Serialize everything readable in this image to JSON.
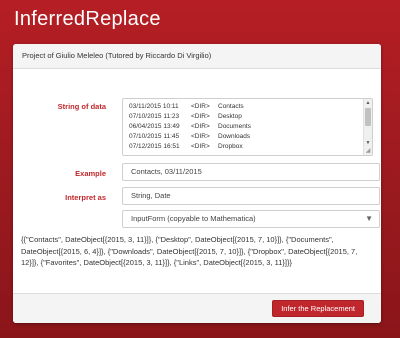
{
  "app": {
    "title": "InferredReplace"
  },
  "panel": {
    "header": "Project of Giulio Meleleo (Tutored by Riccardo Di Virgilio)"
  },
  "form": {
    "string_label": "String of data",
    "string_lines": [
      {
        "date": "03/11/2015 10:11",
        "dir": "<DIR>",
        "name": "Contacts"
      },
      {
        "date": "07/10/2015 11:23",
        "dir": "<DIR>",
        "name": "Desktop"
      },
      {
        "date": "06/04/2015 13:49",
        "dir": "<DIR>",
        "name": "Documents"
      },
      {
        "date": "07/10/2015 11:45",
        "dir": "<DIR>",
        "name": "Downloads"
      },
      {
        "date": "07/12/2015 16:51",
        "dir": "<DIR>",
        "name": "Dropbox"
      }
    ],
    "example_label": "Example",
    "example_value": "Contacts, 03/11/2015",
    "interpret_label": "Interpret as",
    "interpret_value": "String, Date",
    "format_selected": "InputForm (copyable to Mathematica)"
  },
  "result": {
    "text": "{{\"Contacts\", DateObject[{2015, 3, 11}]}, {\"Desktop\", DateObject[{2015, 7, 10}]}, {\"Documents\", DateObject[{2015, 6, 4}]}, {\"Downloads\", DateObject[{2015, 7, 10}]}, {\"Dropbox\", DateObject[{2015, 7, 12}]}, {\"Favorites\", DateObject[{2015, 3, 11}]}, {\"Links\", DateObject[{2015, 3, 11}]}}"
  },
  "footer": {
    "button_label": "Infer the Replacement"
  },
  "colors": {
    "brand": "#b51e24",
    "button": "#c0272d",
    "label": "#c0272d"
  },
  "icons": {
    "select_caret": "chevron-down-icon",
    "scroll_up": "arrow-up-icon",
    "scroll_down": "arrow-down-icon",
    "resize": "resize-handle-icon"
  }
}
